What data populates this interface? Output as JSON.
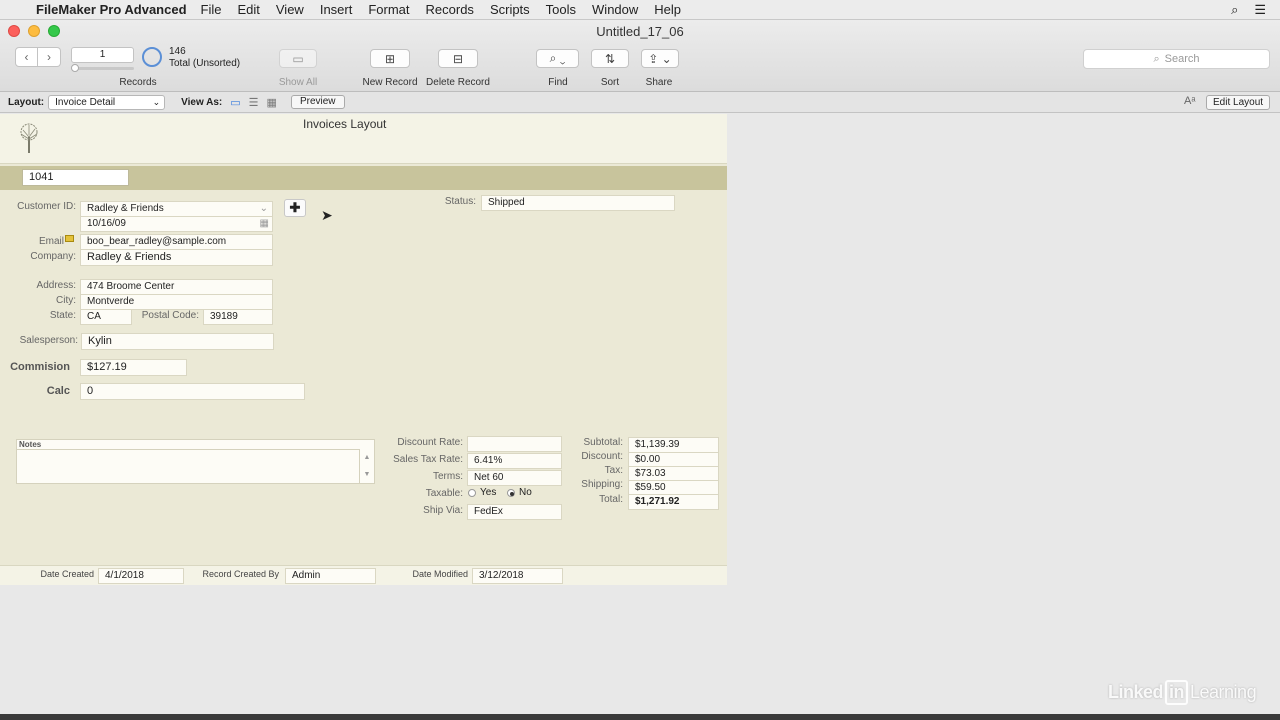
{
  "menubar": {
    "app_name": "FileMaker Pro Advanced",
    "items": [
      "File",
      "Edit",
      "View",
      "Insert",
      "Format",
      "Records",
      "Scripts",
      "Tools",
      "Window",
      "Help"
    ],
    "apple_glyph": "",
    "search_glyph": "⌕",
    "list_glyph": "☰"
  },
  "window": {
    "title": "Untitled_17_06"
  },
  "toolbar": {
    "prev_glyph": "‹",
    "next_glyph": "›",
    "record_number": "1",
    "found_count": "146",
    "found_status": "Total (Unsorted)",
    "records_label": "Records",
    "show_all_label": "Show All",
    "new_record_label": "New Record",
    "delete_record_label": "Delete Record",
    "find_label": "Find",
    "sort_label": "Sort",
    "share_label": "Share",
    "search_placeholder": "Search",
    "icons": {
      "show_all": "▭",
      "new_record": "⊞",
      "delete_record": "⊟",
      "find": "⌕ ⌄",
      "sort": "⇅",
      "share": "⇪ ⌄",
      "search": "⌕"
    }
  },
  "layoutbar": {
    "layout_label": "Layout:",
    "layout_value": "Invoice Detail",
    "view_as_label": "View As:",
    "view_icons": [
      "▭",
      "☰",
      "▦"
    ],
    "preview_label": "Preview",
    "font_size_glyph": "Aᵃ",
    "edit_layout_label": "Edit Layout"
  },
  "form": {
    "layout_title": "Invoices Layout",
    "invoice_id": "1041",
    "customer_id_label": "Customer ID:",
    "customer_id_value": "Radley & Friends",
    "date_value": "10/16/09",
    "email_label": "Email",
    "email_value": "boo_bear_radley@sample.com",
    "company_label": "Company:",
    "company_value": "Radley & Friends",
    "address_label": "Address:",
    "address_value": "474 Broome Center",
    "city_label": "City:",
    "city_value": "Montverde",
    "state_label": "State:",
    "state_value": "CA",
    "postal_label": "Postal Code:",
    "postal_value": "39189",
    "salesperson_label": "Salesperson:",
    "salesperson_value": "Kylin",
    "commission_label": "Commision",
    "commission_value": "$127.19",
    "calc_label": "Calc",
    "calc_value": "0",
    "status_label": "Status:",
    "status_value": "Shipped",
    "notes_label": "Notes",
    "discount_rate_label": "Discount Rate:",
    "discount_rate_value": "",
    "sales_tax_rate_label": "Sales Tax Rate:",
    "sales_tax_rate_value": "6.41%",
    "terms_label": "Terms:",
    "terms_value": "Net 60",
    "taxable_label": "Taxable:",
    "taxable_yes": "Yes",
    "taxable_no": "No",
    "ship_via_label": "Ship Via:",
    "ship_via_value": "FedEx",
    "subtotal_label": "Subtotal:",
    "subtotal_value": "$1,139.39",
    "discount_label": "Discount:",
    "discount_value": "$0.00",
    "tax_label": "Tax:",
    "tax_value": "$73.03",
    "shipping_label": "Shipping:",
    "shipping_value": "$59.50",
    "total_label": "Total:",
    "total_value": "$1,271.92",
    "plus_glyph": "✚",
    "cursor_glyph": "➤"
  },
  "footer": {
    "date_created_label": "Date Created",
    "date_created_value": "4/1/2018",
    "record_created_by_label": "Record Created By",
    "record_created_by_value": "Admin",
    "date_modified_label": "Date Modified",
    "date_modified_value": "3/12/2018"
  },
  "watermark": {
    "part1": "Linked",
    "part2": "in",
    "part3": "Learning"
  }
}
